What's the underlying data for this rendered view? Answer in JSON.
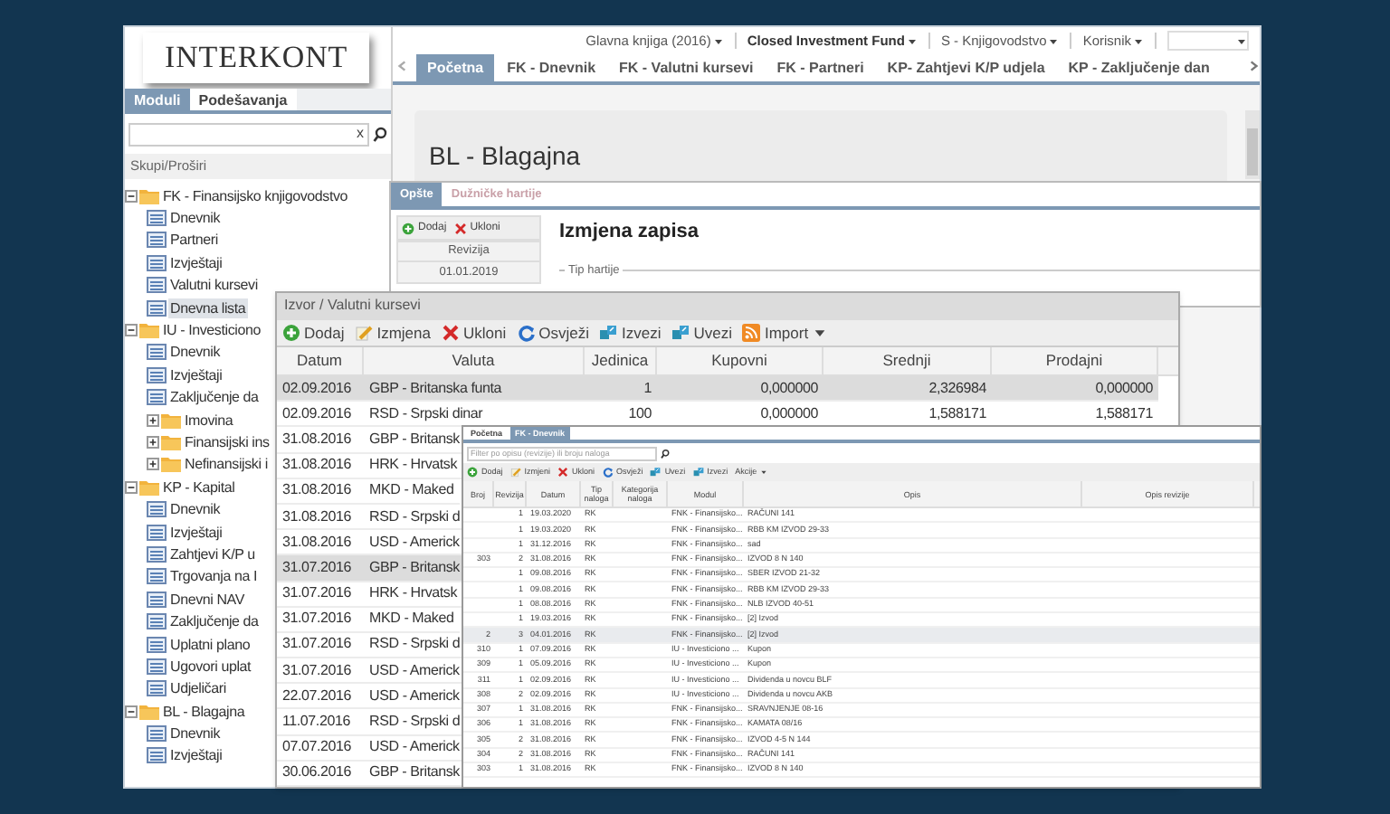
{
  "logo": "INTERKONT",
  "sidebar": {
    "tabs": [
      {
        "label": "Moduli",
        "selected": true
      },
      {
        "label": "Podešavanja",
        "selected": false
      }
    ],
    "search_clear": "x",
    "collapse_label": "Skupi/Proširi",
    "tree": [
      {
        "kind": "folder",
        "label": "FK - Finansijsko knjigovodstvo",
        "expanded": true,
        "selected": false,
        "children": [
          {
            "kind": "leaf",
            "label": "Dnevnik",
            "selected": false
          },
          {
            "kind": "leaf",
            "label": "Partneri",
            "selected": false
          },
          {
            "kind": "leaf",
            "label": "Izvještaji",
            "selected": false
          },
          {
            "kind": "leaf",
            "label": "Valutni kursevi",
            "selected": false
          },
          {
            "kind": "leaf",
            "label": "Dnevna lista",
            "selected": true
          }
        ]
      },
      {
        "kind": "folder",
        "label": "IU - Investiciono",
        "expanded": true,
        "selected": false,
        "children": [
          {
            "kind": "leaf",
            "label": "Dnevnik",
            "selected": false
          },
          {
            "kind": "leaf",
            "label": "Izvještaji",
            "selected": false
          },
          {
            "kind": "leaf",
            "label": "Zaključenje da",
            "selected": false
          },
          {
            "kind": "folder",
            "label": "Imovina",
            "expanded": false,
            "selected": false
          },
          {
            "kind": "folder",
            "label": "Finansijski ins",
            "expanded": false,
            "selected": false
          },
          {
            "kind": "folder",
            "label": "Nefinansijski i",
            "expanded": false,
            "selected": false
          }
        ]
      },
      {
        "kind": "folder",
        "label": "KP - Kapital",
        "expanded": true,
        "selected": false,
        "children": [
          {
            "kind": "leaf",
            "label": "Dnevnik",
            "selected": false
          },
          {
            "kind": "leaf",
            "label": "Izvještaji",
            "selected": false
          },
          {
            "kind": "leaf",
            "label": "Zahtjevi K/P u",
            "selected": false
          },
          {
            "kind": "leaf",
            "label": "Trgovanja na I",
            "selected": false
          },
          {
            "kind": "leaf",
            "label": "Dnevni NAV",
            "selected": false
          },
          {
            "kind": "leaf",
            "label": "Zaključenje da",
            "selected": false
          },
          {
            "kind": "leaf",
            "label": "Uplatni plano",
            "selected": false
          },
          {
            "kind": "leaf",
            "label": "Ugovori uplat",
            "selected": false
          },
          {
            "kind": "leaf",
            "label": "Udjeličari",
            "selected": false
          }
        ]
      },
      {
        "kind": "folder",
        "label": "BL - Blagajna",
        "expanded": true,
        "selected": false,
        "children": [
          {
            "kind": "leaf",
            "label": "Dnevnik",
            "selected": false
          },
          {
            "kind": "leaf",
            "label": "Izvještaji",
            "selected": false
          }
        ]
      }
    ]
  },
  "top_menu": [
    {
      "label": "Glavna knjiga (2016)",
      "bold": false
    },
    {
      "label": "Closed Investment Fund",
      "bold": true
    },
    {
      "label": "S - Knjigovodstvo",
      "bold": false
    },
    {
      "label": "Korisnik",
      "bold": false
    }
  ],
  "tabs": [
    {
      "label": "Početna",
      "selected": true
    },
    {
      "label": "FK - Dnevnik",
      "selected": false
    },
    {
      "label": "FK - Valutni kursevi",
      "selected": false
    },
    {
      "label": "FK - Partneri",
      "selected": false
    },
    {
      "label": "KP- Zahtjevi K/P udjela",
      "selected": false
    },
    {
      "label": "KP - Zaključenje dan",
      "selected": false
    }
  ],
  "panel_title": "BL - Blagajna",
  "record_window": {
    "tabs": [
      {
        "label": "Opšte",
        "selected": true
      },
      {
        "label": "Dužničke hartije",
        "selected": false
      }
    ],
    "toolbar": [
      {
        "kind": "add",
        "label": "Dodaj"
      },
      {
        "kind": "remove",
        "label": "Ukloni"
      }
    ],
    "column": "Revizija",
    "rows": [
      "01.01.2019"
    ],
    "title": "Izmjena zapisa",
    "group": "Tip hartije"
  },
  "rates_window": {
    "title": "Izvor / Valutni kursevi",
    "toolbar": [
      {
        "kind": "add",
        "label": "Dodaj"
      },
      {
        "kind": "edit",
        "label": "Izmjena"
      },
      {
        "kind": "remove",
        "label": "Ukloni"
      },
      {
        "kind": "refresh",
        "label": "Osvježi"
      },
      {
        "kind": "export",
        "label": "Izvezi"
      },
      {
        "kind": "import",
        "label": "Uvezi"
      },
      {
        "kind": "feed",
        "label": "Import"
      }
    ],
    "columns": [
      "Datum",
      "Valuta",
      "Jedinica",
      "Kupovni",
      "Srednji",
      "Prodajni"
    ],
    "rows": [
      {
        "cells": [
          "02.09.2016",
          "GBP - Britanska funta",
          "1",
          "0,000000",
          "2,326984",
          "0,000000"
        ],
        "selected": true
      },
      {
        "cells": [
          "02.09.2016",
          "RSD - Srpski dinar",
          "100",
          "0,000000",
          "1,588171",
          "1,588171"
        ],
        "selected": false
      },
      {
        "cells": [
          "31.08.2016",
          "GBP - Britansk"
        ],
        "selected": false
      },
      {
        "cells": [
          "31.08.2016",
          "HRK - Hrvatsk"
        ],
        "selected": false
      },
      {
        "cells": [
          "31.08.2016",
          "MKD - Maked"
        ],
        "selected": false
      },
      {
        "cells": [
          "31.08.2016",
          "RSD - Srpski d"
        ],
        "selected": false
      },
      {
        "cells": [
          "31.08.2016",
          "USD - Americk"
        ],
        "selected": false
      },
      {
        "cells": [
          "31.07.2016",
          "GBP - Britansk"
        ],
        "selected": true
      },
      {
        "cells": [
          "31.07.2016",
          "HRK - Hrvatsk"
        ],
        "selected": false
      },
      {
        "cells": [
          "31.07.2016",
          "MKD - Maked"
        ],
        "selected": false
      },
      {
        "cells": [
          "31.07.2016",
          "RSD - Srpski d"
        ],
        "selected": false
      },
      {
        "cells": [
          "31.07.2016",
          "USD - Americk"
        ],
        "selected": false
      },
      {
        "cells": [
          "22.07.2016",
          "USD - Americk"
        ],
        "selected": false
      },
      {
        "cells": [
          "11.07.2016",
          "RSD - Srpski d"
        ],
        "selected": false
      },
      {
        "cells": [
          "07.07.2016",
          "USD - Americk"
        ],
        "selected": false
      },
      {
        "cells": [
          "30.06.2016",
          "GBP - Britansk"
        ],
        "selected": false
      }
    ]
  },
  "journal_window": {
    "tabs": [
      {
        "label": "Početna",
        "selected": false
      },
      {
        "label": "FK - Dnevnik",
        "selected": true
      }
    ],
    "filter": {
      "placeholder": "Filter po opisu (revizije) ili broju naloga"
    },
    "toolbar": [
      {
        "kind": "add",
        "label": "Dodaj"
      },
      {
        "kind": "edit",
        "label": "Izmjeni"
      },
      {
        "kind": "remove",
        "label": "Ukloni"
      },
      {
        "kind": "refresh",
        "label": "Osvježi"
      },
      {
        "kind": "import",
        "label": "Uvezi"
      },
      {
        "kind": "export",
        "label": "Izvezi"
      },
      {
        "kind": "menu",
        "label": "Akcije"
      }
    ],
    "columns": [
      "Broj",
      "Revizija",
      "Datum",
      "Tip naloga",
      "Kategorija naloga",
      "Modul",
      "Opis",
      "Opis revizije"
    ],
    "rows": [
      {
        "cells": [
          "",
          "1",
          "19.03.2020",
          "RK",
          "",
          "FNK - Finansijsko...",
          "RAČUNI 141"
        ],
        "selected": false
      },
      {
        "cells": [
          "",
          "1",
          "19.03.2020",
          "RK",
          "",
          "FNK - Finansijsko...",
          "RBB KM IZVOD 29-33"
        ],
        "selected": false
      },
      {
        "cells": [
          "",
          "1",
          "31.12.2016",
          "RK",
          "",
          "FNK - Finansijsko...",
          "sad"
        ],
        "selected": false
      },
      {
        "cells": [
          "303",
          "2",
          "31.08.2016",
          "RK",
          "",
          "FNK - Finansijsko...",
          "IZVOD 8 N 140"
        ],
        "selected": false
      },
      {
        "cells": [
          "",
          "1",
          "09.08.2016",
          "RK",
          "",
          "FNK - Finansijsko...",
          "SBER IZVOD 21-32"
        ],
        "selected": false
      },
      {
        "cells": [
          "",
          "1",
          "09.08.2016",
          "RK",
          "",
          "FNK - Finansijsko...",
          "RBB KM IZVOD 29-33"
        ],
        "selected": false
      },
      {
        "cells": [
          "",
          "1",
          "08.08.2016",
          "RK",
          "",
          "FNK - Finansijsko...",
          "NLB IZVOD 40-51"
        ],
        "selected": false
      },
      {
        "cells": [
          "",
          "1",
          "19.03.2016",
          "RK",
          "",
          "FNK - Finansijsko...",
          "[2] Izvod"
        ],
        "selected": false
      },
      {
        "cells": [
          "2",
          "3",
          "04.01.2016",
          "RK",
          "",
          "FNK - Finansijsko...",
          "[2] Izvod"
        ],
        "selected": true
      },
      {
        "cells": [
          "310",
          "1",
          "07.09.2016",
          "RK",
          "",
          "IU - Investiciono ...",
          "Kupon"
        ],
        "selected": false
      },
      {
        "cells": [
          "309",
          "1",
          "05.09.2016",
          "RK",
          "",
          "IU - Investiciono ...",
          "Kupon"
        ],
        "selected": false
      },
      {
        "cells": [
          "311",
          "1",
          "02.09.2016",
          "RK",
          "",
          "IU - Investiciono ...",
          "Dividenda u novcu BLF"
        ],
        "selected": false
      },
      {
        "cells": [
          "308",
          "2",
          "02.09.2016",
          "RK",
          "",
          "IU - Investiciono ...",
          "Dividenda u novcu AKB"
        ],
        "selected": false
      },
      {
        "cells": [
          "307",
          "1",
          "31.08.2016",
          "RK",
          "",
          "FNK - Finansijsko...",
          "SRAVNJENJE 08-16"
        ],
        "selected": false
      },
      {
        "cells": [
          "306",
          "1",
          "31.08.2016",
          "RK",
          "",
          "FNK - Finansijsko...",
          "KAMATA 08/16"
        ],
        "selected": false
      },
      {
        "cells": [
          "305",
          "2",
          "31.08.2016",
          "RK",
          "",
          "FNK - Finansijsko...",
          "IZVOD 4-5 N 144"
        ],
        "selected": false
      },
      {
        "cells": [
          "304",
          "2",
          "31.08.2016",
          "RK",
          "",
          "FNK - Finansijsko...",
          "RAČUNI 141"
        ],
        "selected": false
      },
      {
        "cells": [
          "303",
          "1",
          "31.08.2016",
          "RK",
          "",
          "FNK - Finansijsko...",
          "IZVOD 8 N 140"
        ],
        "selected": false
      }
    ]
  }
}
